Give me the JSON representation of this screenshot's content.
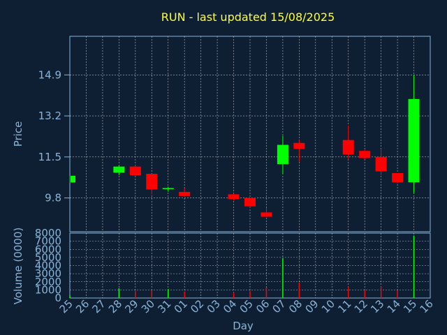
{
  "chart_data": [
    {
      "type": "candlestick",
      "title": "RUN - last updated 15/08/2025",
      "ylabel": "Price",
      "ylim": [
        8.4,
        16.5
      ],
      "yticks": [
        "9.8",
        "11.5",
        "13.2",
        "14.9"
      ],
      "grid": true,
      "colors": {
        "up": "#00ff00",
        "down": "#ff0000",
        "background": "#0f1f33",
        "axis": "#8ab4d8",
        "grid": "#ffffff",
        "title": "#ffff33"
      },
      "x": [
        "25",
        "26",
        "27",
        "28",
        "29",
        "30",
        "31",
        "01",
        "02",
        "03",
        "04",
        "05",
        "06",
        "07",
        "08",
        "09",
        "10",
        "11",
        "12",
        "13",
        "14",
        "15",
        "16"
      ],
      "candles": [
        {
          "day": "25",
          "open": 10.44,
          "high": 10.72,
          "low": 10.44,
          "close": 10.72
        },
        {
          "day": "28",
          "open": 10.85,
          "high": 11.15,
          "low": 10.75,
          "close": 11.1
        },
        {
          "day": "29",
          "open": 11.1,
          "high": 11.15,
          "low": 10.72,
          "close": 10.74
        },
        {
          "day": "30",
          "open": 10.8,
          "high": 10.8,
          "low": 9.95,
          "close": 10.15
        },
        {
          "day": "31",
          "open": 10.19,
          "high": 10.27,
          "low": 10.06,
          "close": 10.21
        },
        {
          "day": "01",
          "open": 10.05,
          "high": 10.2,
          "low": 9.85,
          "close": 9.88
        },
        {
          "day": "04",
          "open": 9.95,
          "high": 9.98,
          "low": 9.7,
          "close": 9.75
        },
        {
          "day": "05",
          "open": 9.8,
          "high": 9.8,
          "low": 9.4,
          "close": 9.45
        },
        {
          "day": "06",
          "open": 9.2,
          "high": 9.38,
          "low": 9.0,
          "close": 9.02
        },
        {
          "day": "07",
          "open": 11.2,
          "high": 12.38,
          "low": 10.8,
          "close": 12.0
        },
        {
          "day": "08",
          "open": 12.08,
          "high": 12.2,
          "low": 11.3,
          "close": 11.83
        },
        {
          "day": "11",
          "open": 12.2,
          "high": 12.8,
          "low": 11.4,
          "close": 11.6
        },
        {
          "day": "12",
          "open": 11.75,
          "high": 11.8,
          "low": 11.4,
          "close": 11.45
        },
        {
          "day": "13",
          "open": 11.5,
          "high": 11.8,
          "low": 10.75,
          "close": 10.9
        },
        {
          "day": "14",
          "open": 10.83,
          "high": 10.83,
          "low": 10.4,
          "close": 10.45
        },
        {
          "day": "15",
          "open": 10.45,
          "high": 14.9,
          "low": 10.0,
          "close": 13.9
        }
      ]
    },
    {
      "type": "bar",
      "ylabel": "Volume (0000)",
      "xlabel": "Day",
      "ylim": [
        0,
        8000
      ],
      "yticks": [
        "0",
        "1000",
        "2000",
        "3000",
        "4000",
        "5000",
        "6000",
        "7000",
        "8000"
      ],
      "categories": [
        "25",
        "28",
        "29",
        "30",
        "31",
        "01",
        "04",
        "05",
        "06",
        "07",
        "08",
        "11",
        "12",
        "13",
        "14",
        "15"
      ],
      "values": [
        300,
        1200,
        900,
        1000,
        1100,
        800,
        700,
        900,
        1300,
        4900,
        1900,
        1400,
        1000,
        1400,
        1000,
        7700
      ],
      "bar_colors": [
        "up",
        "up",
        "down",
        "down",
        "up",
        "down",
        "down",
        "down",
        "down",
        "up",
        "down",
        "down",
        "down",
        "down",
        "down",
        "up"
      ]
    }
  ]
}
